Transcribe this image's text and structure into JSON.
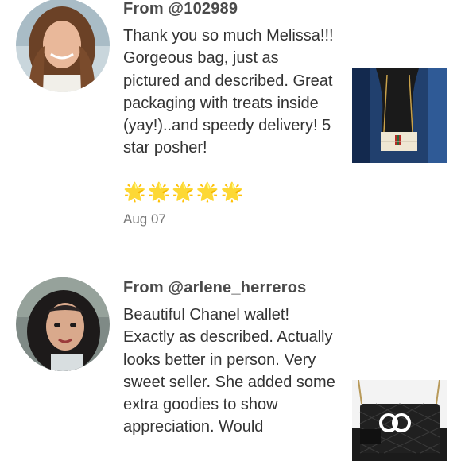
{
  "reviews": [
    {
      "from": "From @102989",
      "text": "Thank you so much Melissa!!! Gorgeous bag, just as pictured and described. Great packaging with treats inside (yay!)..and speedy delivery! 5 star posher!",
      "stars": "🌟🌟🌟🌟🌟",
      "date": "Aug 07"
    },
    {
      "from": "From @arlene_herreros",
      "text": "Beautiful Chanel wallet! Exactly as described. Actually looks better in person. Very sweet seller. She added some extra goodies to show appreciation. Would"
    }
  ],
  "colors": {
    "divider": "#e6e6e6",
    "date": "#777777",
    "text": "#333333"
  }
}
